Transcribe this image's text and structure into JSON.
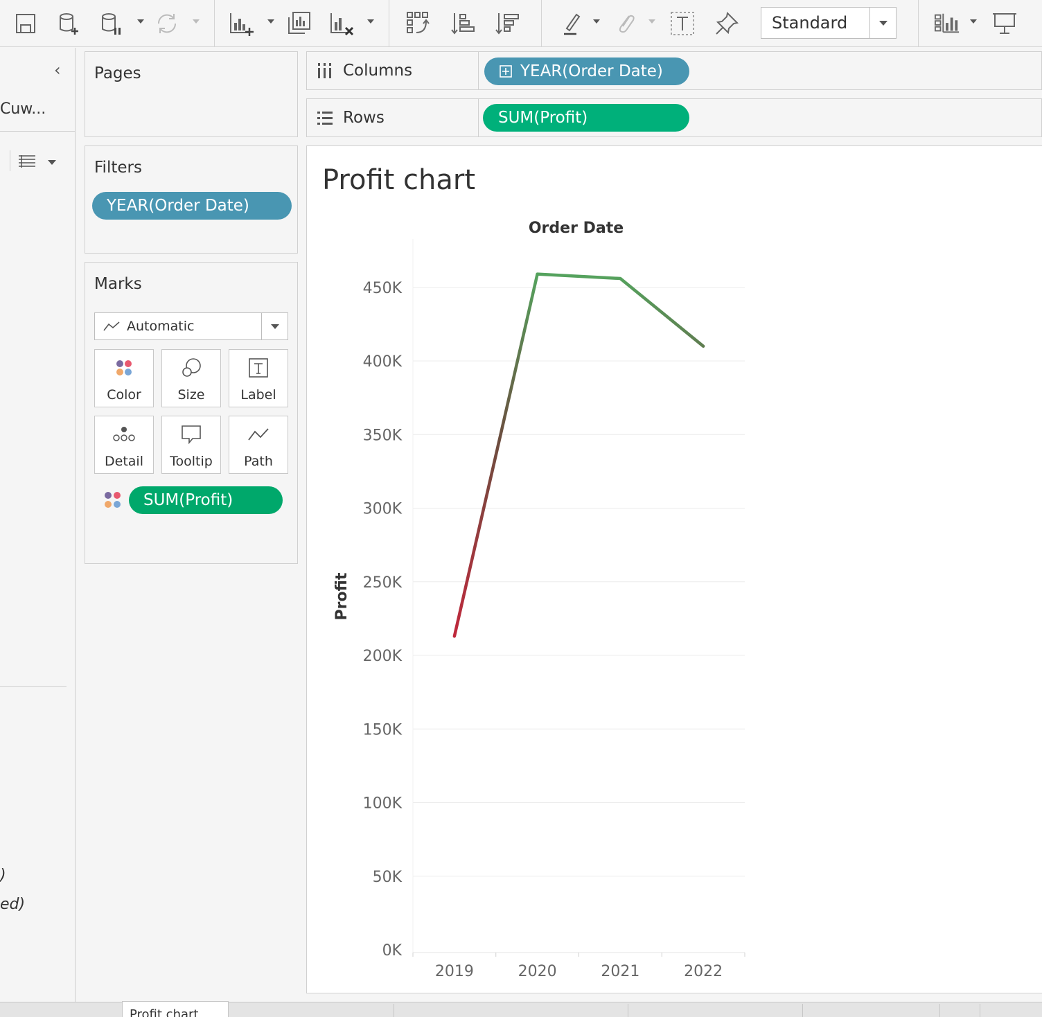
{
  "toolbar": {
    "standard_label": "Standard"
  },
  "data_pane": {
    "source_label": "Cuw...",
    "fragments": [
      ")",
      "ed)"
    ]
  },
  "pages_card": {
    "title": "Pages"
  },
  "filters_card": {
    "title": "Filters",
    "pill": "YEAR(Order Date)"
  },
  "marks_card": {
    "title": "Marks",
    "mark_type": "Automatic",
    "buttons": [
      "Color",
      "Size",
      "Label",
      "Detail",
      "Tooltip",
      "Path"
    ],
    "color_pill": "SUM(Profit)"
  },
  "shelves": {
    "columns_label": "Columns",
    "columns_pill": "YEAR(Order Date)",
    "rows_label": "Rows",
    "rows_pill": "SUM(Profit)"
  },
  "viz": {
    "title": "Profit chart"
  },
  "tabs": {
    "active": "Profit chart"
  },
  "chart_data": {
    "type": "line",
    "title": "Profit chart",
    "xlabel": "Order Date",
    "ylabel": "Profit",
    "categories": [
      "2019",
      "2020",
      "2021",
      "2022"
    ],
    "series": [
      {
        "values": [
          213000,
          459000,
          456000,
          410000
        ]
      }
    ],
    "ylim": [
      0,
      480000
    ],
    "yticks": [
      0,
      50000,
      100000,
      150000,
      200000,
      250000,
      300000,
      350000,
      400000,
      450000
    ],
    "ytick_labels": [
      "0K",
      "50K",
      "100K",
      "150K",
      "200K",
      "250K",
      "300K",
      "350K",
      "400K",
      "450K"
    ],
    "color_scale": {
      "low": "#c0283c",
      "high": "#55a35e"
    },
    "grid": true,
    "legend": "none"
  }
}
